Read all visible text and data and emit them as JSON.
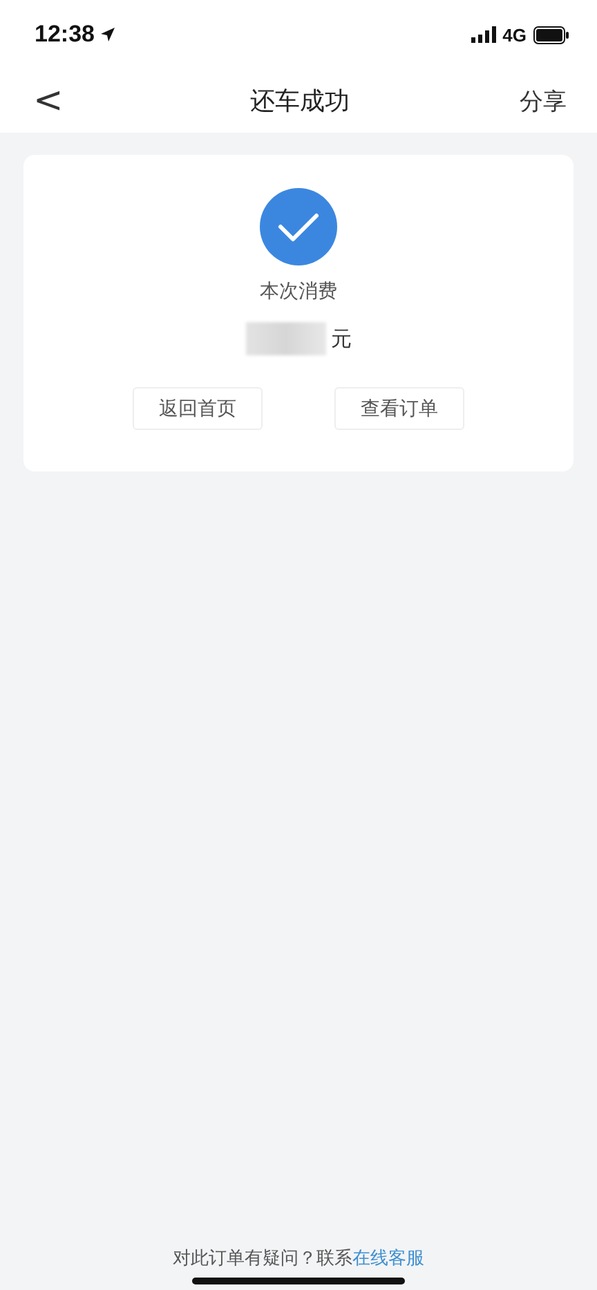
{
  "status_bar": {
    "time": "12:38",
    "network": "4G"
  },
  "nav": {
    "back": "<",
    "title": "还车成功",
    "action": "分享"
  },
  "result": {
    "label": "本次消费",
    "unit": "元",
    "amount_blurred": true
  },
  "buttons": [
    {
      "label": "返回首页"
    },
    {
      "label": "查看订单"
    }
  ],
  "footer": {
    "text": "对此订单有疑问？联系",
    "link": "在线客服"
  }
}
